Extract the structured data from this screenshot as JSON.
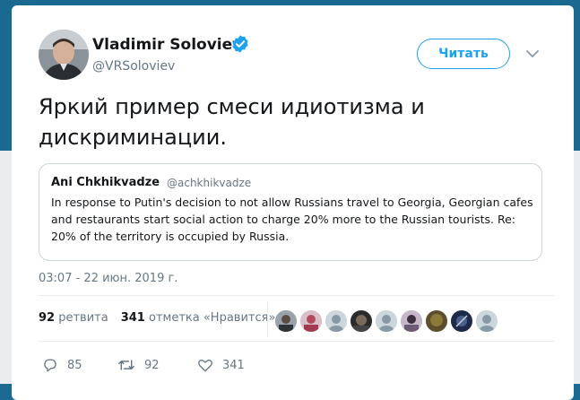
{
  "tweet": {
    "author_name": "Vladimir Soloviev",
    "author_handle": "@VRSoloviev",
    "follow_label": "Читать",
    "text": "Яркий пример смеси идиотизма и дискриминации.",
    "timestamp": "03:07 - 22 июн. 2019 г."
  },
  "quoted": {
    "author_name": "Ani Chkhikvadze",
    "author_handle": "@achkhikvadze",
    "text": "In response to Putin's decision to not allow Russians travel to Georgia, Georgian cafes and restaurants start social action to charge 20% more to the Russian tourists. Re: 20% of the territory is occupied by Russia."
  },
  "stats": {
    "retweets_count": "92",
    "retweets_label": "ретвита",
    "likes_count": "341",
    "likes_label": "отметка «Нравится»"
  },
  "actions": {
    "reply_count": "85",
    "retweet_count": "92",
    "like_count": "341"
  },
  "icons": {
    "verified": "verified-badge-icon",
    "chevron": "chevron-down-icon",
    "reply": "reply-icon",
    "retweet": "retweet-icon",
    "like": "heart-icon"
  },
  "colors": {
    "accent": "#1da1f2",
    "text": "#14171a",
    "muted": "#657786",
    "backdrop": "#1a6991"
  }
}
